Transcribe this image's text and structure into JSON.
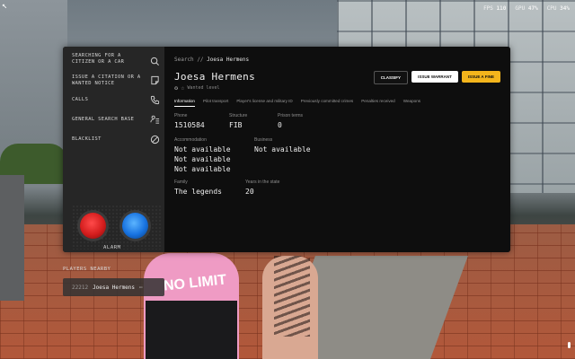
{
  "hud": {
    "fps_label": "FPS",
    "fps": "110",
    "gpu_label": "GPU",
    "gpu": "47%",
    "cpu_label": "CPU",
    "cpu": "34%"
  },
  "scene": {
    "shirt_text": "NO LIMIT"
  },
  "sidebar": {
    "items": [
      {
        "label": "Searching for a citizen or a car",
        "icon": "search-icon"
      },
      {
        "label": "Issue a citation or a wanted notice",
        "icon": "note-icon"
      },
      {
        "label": "Calls",
        "icon": "phone-icon"
      },
      {
        "label": "General search base",
        "icon": "people-search-icon"
      },
      {
        "label": "Blacklist",
        "icon": "ban-icon"
      }
    ],
    "alarm_label": "ALARM"
  },
  "players_nearby": {
    "title": "PLAYERS NEARBY",
    "player_id": "22212",
    "player_name": "Joesa Hermens",
    "menu": "⋯"
  },
  "content": {
    "breadcrumb_root": "Search",
    "breadcrumb_sep": "//",
    "breadcrumb_current": "Joesa Hermens",
    "name": "Joesa Hermens",
    "status": "Wanted level",
    "buttons": {
      "classify": "CLASSIFY",
      "warrant": "ISSUE WARRANT",
      "fine": "ISSUE A FINE"
    },
    "tabs": [
      "Information",
      "Pilot transport",
      "Player's license and military ID",
      "Previously committed crimes",
      "Penalties received",
      "Weapons"
    ],
    "fields": {
      "phone_label": "Phone",
      "phone": "1510584",
      "structure_label": "Structure",
      "structure": "FIB",
      "prison_label": "Prison terms",
      "prison": "0",
      "accommodation_label": "Accommodation",
      "accommodation": [
        "Not available",
        "Not available",
        "Not available"
      ],
      "business_label": "Business",
      "business": "Not available",
      "family_label": "Family",
      "family": "The legends",
      "years_label": "Years in the state",
      "years": "20"
    }
  },
  "colors": {
    "accent_yellow": "#f4b51c",
    "panel": "#0e0e0e",
    "sidebar": "#262626"
  }
}
